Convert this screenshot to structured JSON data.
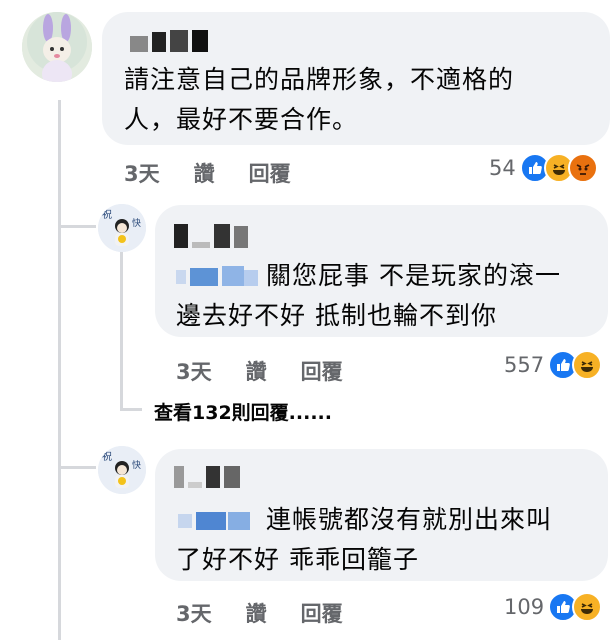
{
  "comments": [
    {
      "text_lines": [
        "請注意自己的品牌形象，不適格的",
        "人，最好不要合作。"
      ],
      "time": "3天",
      "like": "讚",
      "reply": "回覆",
      "reaction_count": "54",
      "reactions": [
        "like-icon",
        "haha-icon",
        "angry-icon"
      ]
    },
    {
      "text_lines": [
        "關您屁事 不是玩家的滾一",
        "邊去好不好 抵制也輪不到你"
      ],
      "time": "3天",
      "like": "讚",
      "reply": "回覆",
      "reaction_count": "557",
      "reactions": [
        "like-icon",
        "haha-icon"
      ]
    },
    {
      "text_lines": [
        "連帳號都沒有就別出來叫",
        "了好不好 乖乖回籠子"
      ],
      "time": "3天",
      "like": "讚",
      "reply": "回覆",
      "reaction_count": "109",
      "reactions": [
        "like-icon",
        "haha-icon"
      ]
    }
  ],
  "view_more_replies": "查看132則回覆......",
  "colors": {
    "bubble": "#f0f2f5",
    "secondary_text": "#65676b",
    "like_blue": "#1877f2",
    "haha_yellow": "#f7b125",
    "angry_orange": "#e9710f"
  }
}
